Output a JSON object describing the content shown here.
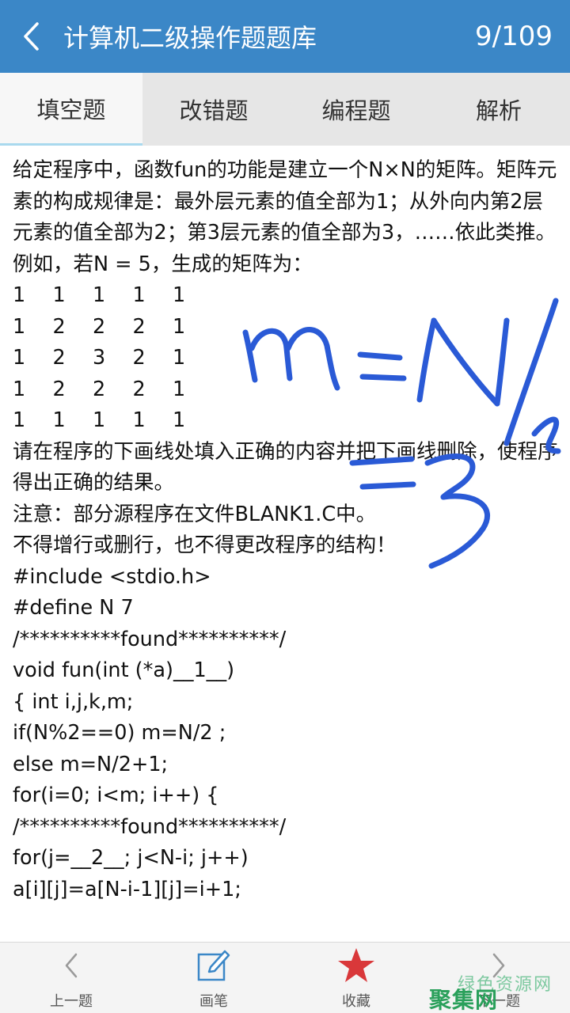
{
  "header": {
    "title": "计算机二级操作题题库",
    "counter": "9/109"
  },
  "tabs": [
    {
      "label": "填空题",
      "active": true
    },
    {
      "label": "改错题",
      "active": false
    },
    {
      "label": "编程题",
      "active": false
    },
    {
      "label": "解析",
      "active": false
    }
  ],
  "content": {
    "intro": "给定程序中，函数fun的功能是建立一个N×N的矩阵。矩阵元素的构成规律是：最外层元素的值全部为1；从外向内第2层元素的值全部为2；第3层元素的值全部为3，……依此类推。例如，若N = 5，生成的矩阵为：",
    "matrix": [
      [
        "1",
        "1",
        "1",
        "1",
        "1"
      ],
      [
        "1",
        "2",
        "2",
        "2",
        "1"
      ],
      [
        "1",
        "2",
        "3",
        "2",
        "1"
      ],
      [
        "1",
        "2",
        "2",
        "2",
        "1"
      ],
      [
        "1",
        "1",
        "1",
        "1",
        "1"
      ]
    ],
    "instruction": "请在程序的下画线处填入正确的内容并把下画线删除，使程序得出正确的结果。",
    "note": "注意：部分源程序在文件BLANK1.C中。",
    "rule": "不得增行或删行，也不得更改程序的结构！",
    "code": [
      "#include <stdio.h>",
      "#define N 7",
      "/**********found**********/",
      "void fun(int (*a)__1__)",
      "{ int i,j,k,m;",
      "if(N%2==0) m=N/2 ;",
      "else m=N/2+1;",
      "for(i=0; i<m; i++) {",
      "/**********found**********/",
      "for(j=__2__; j<N-i; j++)",
      "a[i][j]=a[N-i-1][j]=i+1;"
    ]
  },
  "handwriting_color": "#2a5ad6",
  "bottom_nav": [
    {
      "label": "上一题",
      "icon": "chevron-left-icon"
    },
    {
      "label": "画笔",
      "icon": "pen-icon"
    },
    {
      "label": "收藏",
      "icon": "star-icon"
    },
    {
      "label": "下一题",
      "icon": "chevron-right-icon"
    }
  ],
  "watermark": {
    "top": "绿色资源网",
    "main": "聚集网"
  },
  "colors": {
    "header_bg": "#3b87c7",
    "star": "#d9383a",
    "pen_icon": "#3b87c7"
  }
}
